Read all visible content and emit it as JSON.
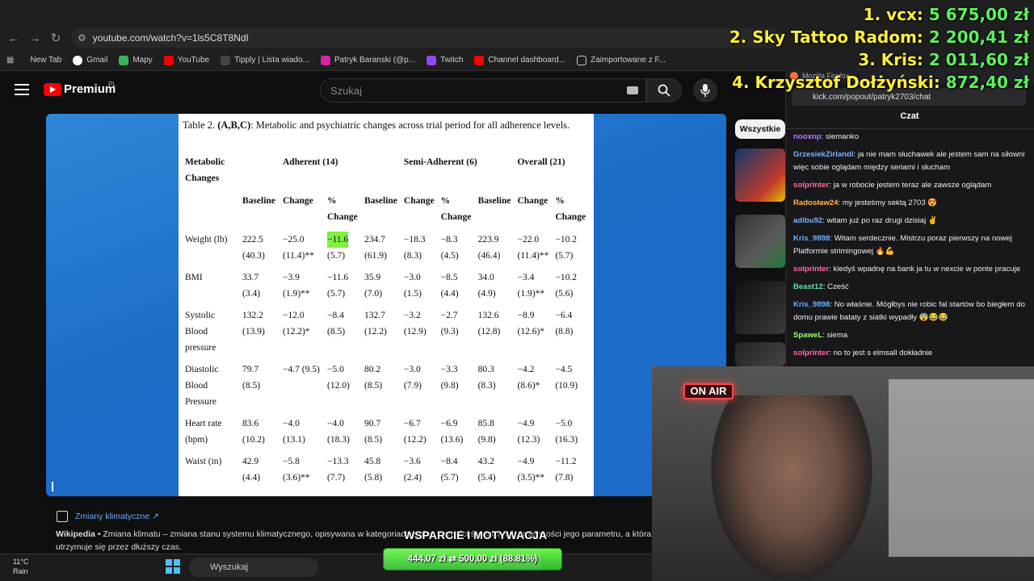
{
  "browser": {
    "url": "youtube.com/watch?v=1ls5C8T8NdI",
    "bookmarks": [
      "New Tab",
      "Gmail",
      "Mapy",
      "YouTube",
      "Tipply | Lista wiado...",
      "Patryk Baranski (@p...",
      "Twitch",
      "Channel dashboard...",
      "Zaimportowane z F..."
    ]
  },
  "youtube": {
    "logo": "Premium",
    "region": "PL",
    "search_placeholder": "Szukaj",
    "filter_chip": "Wszystkie"
  },
  "paper": {
    "caption_label": "Table 2.",
    "caption_bold": "(A,B,C)",
    "caption_text": ": Metabolic and psychiatric changes across trial period for all adherence levels.",
    "group_headers": {
      "first": "Metabolic Changes",
      "adherent": "Adherent (14)",
      "semi": "Semi-Adherent (6)",
      "overall": "Overall (21)"
    },
    "col_headers": [
      "Baseline",
      "Change",
      "% Change",
      "Baseline",
      "Change",
      "% Change",
      "Baseline",
      "Change",
      "% Change"
    ],
    "rows": [
      {
        "label": "Weight (lb)",
        "cells": [
          [
            "222.5",
            "(40.3)"
          ],
          [
            "−25.0",
            "(11.4)**"
          ],
          [
            "−11.6",
            "(5.7)"
          ],
          [
            "234.7",
            "(61.9)"
          ],
          [
            "−18.3",
            "(8.3)"
          ],
          [
            "−8.3",
            "(4.5)"
          ],
          [
            "223.9",
            "(46.4)"
          ],
          [
            "−22.0",
            "(11.4)**"
          ],
          [
            "−10.2",
            "(5.7)"
          ]
        ]
      },
      {
        "label": "BMI",
        "cells": [
          [
            "33.7",
            "(3.4)"
          ],
          [
            "−3.9",
            "(1.9)**"
          ],
          [
            "−11.6",
            "(5.7)"
          ],
          [
            "35.9",
            "(7.0)"
          ],
          [
            "−3.0",
            "(1.5)"
          ],
          [
            "−8.5",
            "(4.4)"
          ],
          [
            "34.0",
            "(4.9)"
          ],
          [
            "−3.4",
            "(1.9)**"
          ],
          [
            "−10.2",
            "(5.6)"
          ]
        ]
      },
      {
        "label": "Systolic Blood pressure",
        "cells": [
          [
            "132.2",
            "(13.9)"
          ],
          [
            "−12.0",
            "(12.2)*"
          ],
          [
            "−8.4",
            "(8.5)"
          ],
          [
            "132.7",
            "(12.2)"
          ],
          [
            "−3.2",
            "(12.9)"
          ],
          [
            "−2.7",
            "(9.3)"
          ],
          [
            "132.6",
            "(12.8)"
          ],
          [
            "−8.9",
            "(12.6)*"
          ],
          [
            "−6.4",
            "(8.8)"
          ]
        ]
      },
      {
        "label": "Diastolic Blood Pressure",
        "cells": [
          [
            "79.7",
            "(8.5)"
          ],
          [
            "−4.7 (9.5)",
            ""
          ],
          [
            "−5.0",
            "(12.0)"
          ],
          [
            "80.2",
            "(8.5)"
          ],
          [
            "−3.0",
            "(7.9)"
          ],
          [
            "−3.3",
            "(9.8)"
          ],
          [
            "80.3",
            "(8.3)"
          ],
          [
            "−4.2",
            "(8.6)*"
          ],
          [
            "−4.5",
            "(10.9)"
          ]
        ]
      },
      {
        "label": "Heart rate (bpm)",
        "cells": [
          [
            "83.6",
            "(10.2)"
          ],
          [
            "−4.0",
            "(13.1)"
          ],
          [
            "−4.0",
            "(18.3)"
          ],
          [
            "90.7",
            "(8.5)"
          ],
          [
            "−6.7",
            "(12.2)"
          ],
          [
            "−6.9",
            "(13.6)"
          ],
          [
            "85.8",
            "(9.8)"
          ],
          [
            "−4.9",
            "(12.3)"
          ],
          [
            "−5.0",
            "(16.3)"
          ]
        ]
      },
      {
        "label": "Waist (in)",
        "cells": [
          [
            "42.9",
            "(4.4)"
          ],
          [
            "−5.8",
            "(3.6)**"
          ],
          [
            "−13.3",
            "(7.7)"
          ],
          [
            "45.8",
            "(5.8)"
          ],
          [
            "−3.6",
            "(2.4)"
          ],
          [
            "−8.4",
            "(5.7)"
          ],
          [
            "43.2",
            "(5.4)"
          ],
          [
            "−4.9",
            "(3.5)**"
          ],
          [
            "−11.2",
            "(7.8)"
          ]
        ]
      }
    ]
  },
  "wiki": {
    "link": "Zmiany klimatyczne ↗",
    "source": "Wikipedia",
    "text": " • Zmiana klimatu – zmiana stanu systemu klimatycznego, opisywana w kategoriach zmian wartości średnich lub zmienności jego parametru, a która utrzymuje się przez dłuższy czas."
  },
  "leaderboard": [
    {
      "name": "1. vcx:",
      "amount": "5 675,00 zł"
    },
    {
      "name": "2. Sky Tattoo Radom:",
      "amount": "2 200,41 zł"
    },
    {
      "name": "3. Kris:",
      "amount": "2 011,60 zł"
    },
    {
      "name": "4. Krzysztof Dołżyński:",
      "amount": "872,40 zł"
    }
  ],
  "chat": {
    "window_title": "Mozilla Firefox",
    "url": "kick.com/popout/patryk2703/chat",
    "title": "Czat",
    "messages": [
      {
        "user": "nooxnp",
        "color": "#b17cff",
        "text": "siemanko"
      },
      {
        "user": "GrzesiekZirlandi",
        "color": "#7fb0ff",
        "text": "ja nie mam słuchawek ale jestem sam na siłowni więc sobie oglądam między seriami i słucham"
      },
      {
        "user": "solprinter",
        "color": "#ff6aa8",
        "text": "ja w robocie jestem teraz ale zawsze oglądam"
      },
      {
        "user": "Radosław24",
        "color": "#ffb84d",
        "text": "my jesteśmy sektą 2703 😍"
      },
      {
        "user": "adibu92",
        "color": "#7fb0ff",
        "text": "witam już po raz drugi dzisiaj ✌"
      },
      {
        "user": "Kris_9898",
        "color": "#6ab0ff",
        "text": "Witam serdecznie. Mistrzu poraz pierwszy na nowej Platformie strimingowej 🔥💪"
      },
      {
        "user": "solprinter",
        "color": "#ff6aa8",
        "text": "kiedyś wpadnę na bank ja tu w nexcie w ponte pracuje"
      },
      {
        "user": "Beast12",
        "color": "#62e0a8",
        "text": "Cześć"
      },
      {
        "user": "Kris_9898",
        "color": "#6ab0ff",
        "text": "No właśnie. Mógłbys nie robic fal startów bo biegłem do domu prawie bataty z siatki wypadły 😨😂😂"
      },
      {
        "user": "SpaweL",
        "color": "#9cff6a",
        "text": "siema"
      },
      {
        "user": "solprinter",
        "color": "#ff6aa8",
        "text": "no to jest s elmsall dokładnie"
      }
    ]
  },
  "stream": {
    "onair": "ON AIR",
    "support_label": "WSPARCIE I MOTYWACJA",
    "donation_text": "444,07 zł ⇄ 500,00 zł (88.81%)",
    "donation_progress": 0.8881
  },
  "taskbar": {
    "temp": "11°C",
    "weather": "Rain",
    "search": "Wyszukaj"
  }
}
